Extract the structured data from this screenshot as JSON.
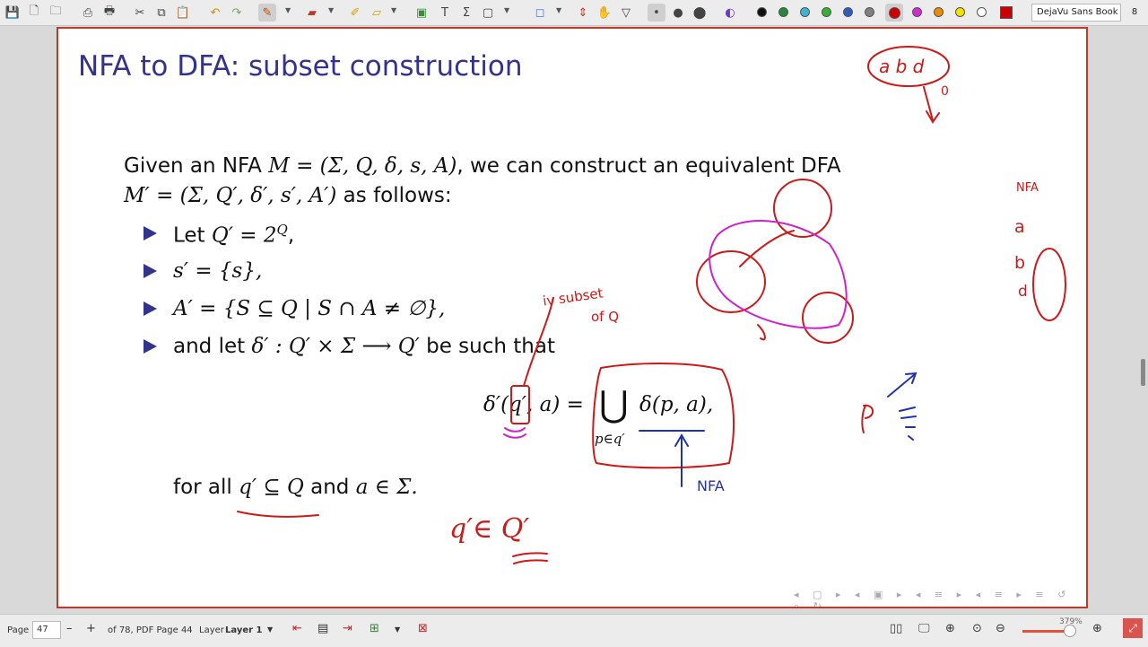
{
  "toolbar": {
    "font_name": "DejaVu Sans Book",
    "font_size": "8",
    "pen_colors": [
      "#111111",
      "#1e8a3a",
      "#3ab5d6",
      "#2fb52f",
      "#2d5bc4",
      "#808080",
      "#cc0000",
      "#d22ad2",
      "#f08a00",
      "#f5e000",
      "#ffffff",
      "#cc0000"
    ]
  },
  "slide": {
    "title": "NFA to DFA: subset construction",
    "intro_line1_a": "Given an NFA ",
    "intro_line1_math": "M = (Σ, Q, δ, s, A)",
    "intro_line1_b": ", we can construct an equivalent DFA",
    "intro_line2_math": "M′ = (Σ, Q′, δ′, s′, A′)",
    "intro_line2_b": " as follows:",
    "bullet1_a": "Let ",
    "bullet1_math": "Q′ = 2",
    "bullet1_sup": "Q",
    "bullet1_b": ",",
    "bullet2_math": "s′ = {s},",
    "bullet3_math": "A′ = {S ⊆ Q | S ∩ A ≠ ∅},",
    "bullet4_a": "and let ",
    "bullet4_math": "δ′ : Q′ × Σ ⟶ Q′",
    "bullet4_b": " be such that",
    "formula_lhs": "δ′(q′, a) =",
    "formula_bigcup": "⋃",
    "formula_sub": "p∈q′",
    "formula_rhs": "δ(p, a),",
    "forall_a": "for all ",
    "forall_math": "q′ ⊆ Q",
    "forall_b": " and ",
    "forall_math2": "a ∈ Σ."
  },
  "annotations": {
    "abd": "a b d",
    "zero": "0",
    "nfa_label_right": "NFA",
    "subset_note_1": "iv subset",
    "subset_note_2": "of Q",
    "nfa_arrow_label": "NFA",
    "q_in_Q": "q′∈ Q′",
    "p_label": "P",
    "row_a": "a",
    "row_b": "b",
    "row_d": "d"
  },
  "status": {
    "page_label": "Page",
    "page_number": "47",
    "page_of": "of 78, PDF Page 44",
    "layer_label": "Layer",
    "layer_value": "Layer 1",
    "zoom_text": "379%",
    "zoom_fraction": 0.8
  }
}
